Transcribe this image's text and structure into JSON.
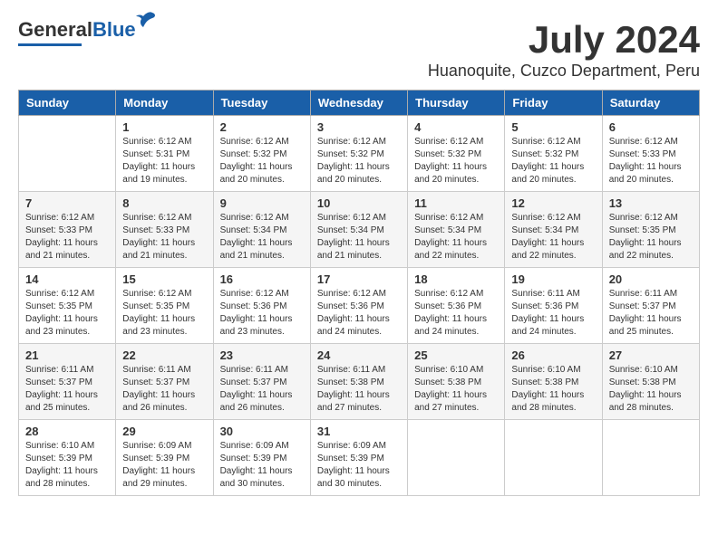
{
  "logo": {
    "general": "General",
    "blue": "Blue"
  },
  "title": {
    "month_year": "July 2024",
    "location": "Huanoquite, Cuzco Department, Peru"
  },
  "headers": [
    "Sunday",
    "Monday",
    "Tuesday",
    "Wednesday",
    "Thursday",
    "Friday",
    "Saturday"
  ],
  "weeks": [
    [
      {
        "day": "",
        "info": ""
      },
      {
        "day": "1",
        "info": "Sunrise: 6:12 AM\nSunset: 5:31 PM\nDaylight: 11 hours\nand 19 minutes."
      },
      {
        "day": "2",
        "info": "Sunrise: 6:12 AM\nSunset: 5:32 PM\nDaylight: 11 hours\nand 20 minutes."
      },
      {
        "day": "3",
        "info": "Sunrise: 6:12 AM\nSunset: 5:32 PM\nDaylight: 11 hours\nand 20 minutes."
      },
      {
        "day": "4",
        "info": "Sunrise: 6:12 AM\nSunset: 5:32 PM\nDaylight: 11 hours\nand 20 minutes."
      },
      {
        "day": "5",
        "info": "Sunrise: 6:12 AM\nSunset: 5:32 PM\nDaylight: 11 hours\nand 20 minutes."
      },
      {
        "day": "6",
        "info": "Sunrise: 6:12 AM\nSunset: 5:33 PM\nDaylight: 11 hours\nand 20 minutes."
      }
    ],
    [
      {
        "day": "7",
        "info": "Sunrise: 6:12 AM\nSunset: 5:33 PM\nDaylight: 11 hours\nand 21 minutes."
      },
      {
        "day": "8",
        "info": "Sunrise: 6:12 AM\nSunset: 5:33 PM\nDaylight: 11 hours\nand 21 minutes."
      },
      {
        "day": "9",
        "info": "Sunrise: 6:12 AM\nSunset: 5:34 PM\nDaylight: 11 hours\nand 21 minutes."
      },
      {
        "day": "10",
        "info": "Sunrise: 6:12 AM\nSunset: 5:34 PM\nDaylight: 11 hours\nand 21 minutes."
      },
      {
        "day": "11",
        "info": "Sunrise: 6:12 AM\nSunset: 5:34 PM\nDaylight: 11 hours\nand 22 minutes."
      },
      {
        "day": "12",
        "info": "Sunrise: 6:12 AM\nSunset: 5:34 PM\nDaylight: 11 hours\nand 22 minutes."
      },
      {
        "day": "13",
        "info": "Sunrise: 6:12 AM\nSunset: 5:35 PM\nDaylight: 11 hours\nand 22 minutes."
      }
    ],
    [
      {
        "day": "14",
        "info": "Sunrise: 6:12 AM\nSunset: 5:35 PM\nDaylight: 11 hours\nand 23 minutes."
      },
      {
        "day": "15",
        "info": "Sunrise: 6:12 AM\nSunset: 5:35 PM\nDaylight: 11 hours\nand 23 minutes."
      },
      {
        "day": "16",
        "info": "Sunrise: 6:12 AM\nSunset: 5:36 PM\nDaylight: 11 hours\nand 23 minutes."
      },
      {
        "day": "17",
        "info": "Sunrise: 6:12 AM\nSunset: 5:36 PM\nDaylight: 11 hours\nand 24 minutes."
      },
      {
        "day": "18",
        "info": "Sunrise: 6:12 AM\nSunset: 5:36 PM\nDaylight: 11 hours\nand 24 minutes."
      },
      {
        "day": "19",
        "info": "Sunrise: 6:11 AM\nSunset: 5:36 PM\nDaylight: 11 hours\nand 24 minutes."
      },
      {
        "day": "20",
        "info": "Sunrise: 6:11 AM\nSunset: 5:37 PM\nDaylight: 11 hours\nand 25 minutes."
      }
    ],
    [
      {
        "day": "21",
        "info": "Sunrise: 6:11 AM\nSunset: 5:37 PM\nDaylight: 11 hours\nand 25 minutes."
      },
      {
        "day": "22",
        "info": "Sunrise: 6:11 AM\nSunset: 5:37 PM\nDaylight: 11 hours\nand 26 minutes."
      },
      {
        "day": "23",
        "info": "Sunrise: 6:11 AM\nSunset: 5:37 PM\nDaylight: 11 hours\nand 26 minutes."
      },
      {
        "day": "24",
        "info": "Sunrise: 6:11 AM\nSunset: 5:38 PM\nDaylight: 11 hours\nand 27 minutes."
      },
      {
        "day": "25",
        "info": "Sunrise: 6:10 AM\nSunset: 5:38 PM\nDaylight: 11 hours\nand 27 minutes."
      },
      {
        "day": "26",
        "info": "Sunrise: 6:10 AM\nSunset: 5:38 PM\nDaylight: 11 hours\nand 28 minutes."
      },
      {
        "day": "27",
        "info": "Sunrise: 6:10 AM\nSunset: 5:38 PM\nDaylight: 11 hours\nand 28 minutes."
      }
    ],
    [
      {
        "day": "28",
        "info": "Sunrise: 6:10 AM\nSunset: 5:39 PM\nDaylight: 11 hours\nand 28 minutes."
      },
      {
        "day": "29",
        "info": "Sunrise: 6:09 AM\nSunset: 5:39 PM\nDaylight: 11 hours\nand 29 minutes."
      },
      {
        "day": "30",
        "info": "Sunrise: 6:09 AM\nSunset: 5:39 PM\nDaylight: 11 hours\nand 30 minutes."
      },
      {
        "day": "31",
        "info": "Sunrise: 6:09 AM\nSunset: 5:39 PM\nDaylight: 11 hours\nand 30 minutes."
      },
      {
        "day": "",
        "info": ""
      },
      {
        "day": "",
        "info": ""
      },
      {
        "day": "",
        "info": ""
      }
    ]
  ]
}
